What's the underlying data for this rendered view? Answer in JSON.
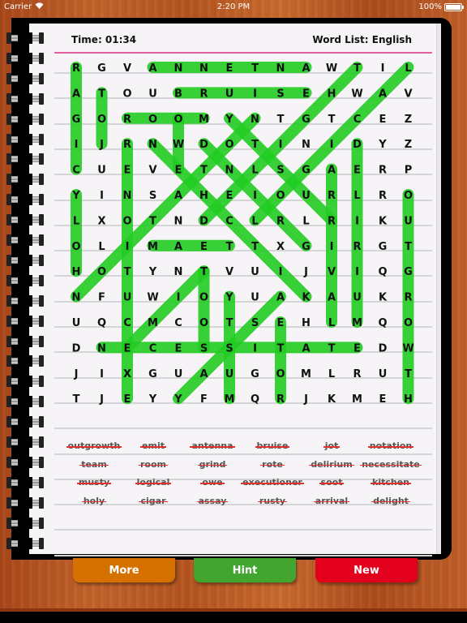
{
  "status_bar": {
    "carrier": "Carrier",
    "time": "2:20 PM",
    "battery": "100%",
    "wifi_icon": "wifi-icon",
    "battery_icon": "battery-icon"
  },
  "header": {
    "timer": "Time: 01:34",
    "word_list_label": "Word List: English"
  },
  "grid": {
    "rows": [
      [
        "R",
        "G",
        "V",
        "A",
        "N",
        "N",
        "E",
        "T",
        "N",
        "A",
        "W",
        "T",
        "I",
        "L"
      ],
      [
        "A",
        "T",
        "O",
        "U",
        "B",
        "R",
        "U",
        "I",
        "S",
        "E",
        "H",
        "W",
        "A",
        "V"
      ],
      [
        "G",
        "O",
        "R",
        "O",
        "O",
        "M",
        "Y",
        "N",
        "T",
        "G",
        "T",
        "C",
        "E",
        "Z"
      ],
      [
        "I",
        "J",
        "R",
        "N",
        "W",
        "D",
        "O",
        "T",
        "I",
        "N",
        "I",
        "D",
        "Y",
        "Z"
      ],
      [
        "C",
        "U",
        "E",
        "V",
        "E",
        "T",
        "N",
        "L",
        "S",
        "G",
        "A",
        "E",
        "R",
        "P"
      ],
      [
        "Y",
        "I",
        "N",
        "S",
        "A",
        "H",
        "E",
        "I",
        "O",
        "U",
        "R",
        "L",
        "R",
        "O"
      ],
      [
        "L",
        "X",
        "O",
        "T",
        "N",
        "D",
        "C",
        "L",
        "R",
        "L",
        "R",
        "I",
        "K",
        "U"
      ],
      [
        "O",
        "L",
        "I",
        "M",
        "A",
        "E",
        "T",
        "T",
        "X",
        "G",
        "I",
        "R",
        "G",
        "T"
      ],
      [
        "H",
        "O",
        "T",
        "Y",
        "N",
        "T",
        "V",
        "U",
        "I",
        "J",
        "V",
        "I",
        "Q",
        "G"
      ],
      [
        "N",
        "F",
        "U",
        "W",
        "I",
        "O",
        "Y",
        "U",
        "A",
        "K",
        "A",
        "U",
        "K",
        "R"
      ],
      [
        "U",
        "Q",
        "C",
        "M",
        "C",
        "O",
        "T",
        "S",
        "E",
        "H",
        "L",
        "M",
        "Q",
        "O"
      ],
      [
        "D",
        "N",
        "E",
        "C",
        "E",
        "S",
        "S",
        "I",
        "T",
        "A",
        "T",
        "E",
        "D",
        "W"
      ],
      [
        "J",
        "I",
        "X",
        "G",
        "U",
        "A",
        "U",
        "G",
        "O",
        "M",
        "L",
        "R",
        "U",
        "T"
      ],
      [
        "T",
        "J",
        "E",
        "Y",
        "Y",
        "F",
        "M",
        "Q",
        "R",
        "J",
        "K",
        "M",
        "E",
        "H"
      ]
    ],
    "highlight_color": "#22cc22",
    "found": [
      {
        "word": "cigar",
        "from": [
          0,
          0
        ],
        "to": [
          4,
          0
        ]
      },
      {
        "word": "antenna",
        "from": [
          0,
          3
        ],
        "to": [
          0,
          9
        ]
      },
      {
        "word": "bruise",
        "from": [
          1,
          4
        ],
        "to": [
          1,
          9
        ]
      },
      {
        "word": "jot",
        "from": [
          1,
          1
        ],
        "to": [
          3,
          1
        ]
      },
      {
        "word": "room",
        "from": [
          2,
          2
        ],
        "to": [
          2,
          5
        ]
      },
      {
        "word": "owe",
        "from": [
          2,
          4
        ],
        "to": [
          4,
          4
        ]
      },
      {
        "word": "kitchen",
        "from": [
          3,
          3
        ],
        "to": [
          9,
          9
        ]
      },
      {
        "word": "grind",
        "from": [
          3,
          5
        ],
        "to": [
          7,
          9
        ]
      },
      {
        "word": "rusty",
        "from": [
          2,
          6
        ],
        "to": [
          6,
          10
        ]
      },
      {
        "word": "notation",
        "from": [
          9,
          0
        ],
        "to": [
          2,
          7
        ]
      },
      {
        "word": "delight",
        "from": [
          0,
          11
        ],
        "to": [
          6,
          5
        ]
      },
      {
        "word": "logical",
        "from": [
          0,
          13
        ],
        "to": [
          6,
          7
        ]
      },
      {
        "word": "executioner",
        "from": [
          3,
          2
        ],
        "to": [
          13,
          2
        ]
      },
      {
        "word": "team",
        "from": [
          7,
          3
        ],
        "to": [
          7,
          6
        ]
      },
      {
        "word": "arrival",
        "from": [
          4,
          10
        ],
        "to": [
          10,
          10
        ]
      },
      {
        "word": "delirium",
        "from": [
          3,
          11
        ],
        "to": [
          10,
          11
        ]
      },
      {
        "word": "outgrowth",
        "from": [
          5,
          13
        ],
        "to": [
          13,
          13
        ]
      },
      {
        "word": "necessitate",
        "from": [
          11,
          1
        ],
        "to": [
          11,
          11
        ]
      },
      {
        "word": "soot",
        "from": [
          8,
          5
        ],
        "to": [
          11,
          5
        ]
      },
      {
        "word": "emit",
        "from": [
          8,
          5
        ],
        "to": [
          11,
          2
        ]
      },
      {
        "word": "musty",
        "from": [
          9,
          6
        ],
        "to": [
          13,
          6
        ]
      },
      {
        "word": "assay",
        "from": [
          9,
          8
        ],
        "to": [
          13,
          4
        ]
      },
      {
        "word": "rote",
        "from": [
          10,
          8
        ],
        "to": [
          13,
          8
        ]
      },
      {
        "word": "holy",
        "from": [
          5,
          0
        ],
        "to": [
          8,
          0
        ]
      }
    ]
  },
  "word_list": [
    [
      "outgrowth",
      "emit",
      "antenna",
      "bruise",
      "jot",
      "notation"
    ],
    [
      "team",
      "room",
      "grind",
      "rote",
      "delirium",
      "necessitate"
    ],
    [
      "musty",
      "logical",
      "owe",
      "executioner",
      "soot",
      "kitchen"
    ],
    [
      "holy",
      "cigar",
      "assay",
      "rusty",
      "arrival",
      "delight"
    ]
  ],
  "buttons": {
    "more": "More",
    "hint": "Hint",
    "new": "New"
  },
  "colors": {
    "more": "#d57100",
    "hint": "#42a52f",
    "new": "#e2001c",
    "strike": "#e23030",
    "header_line": "#e85fa0"
  }
}
